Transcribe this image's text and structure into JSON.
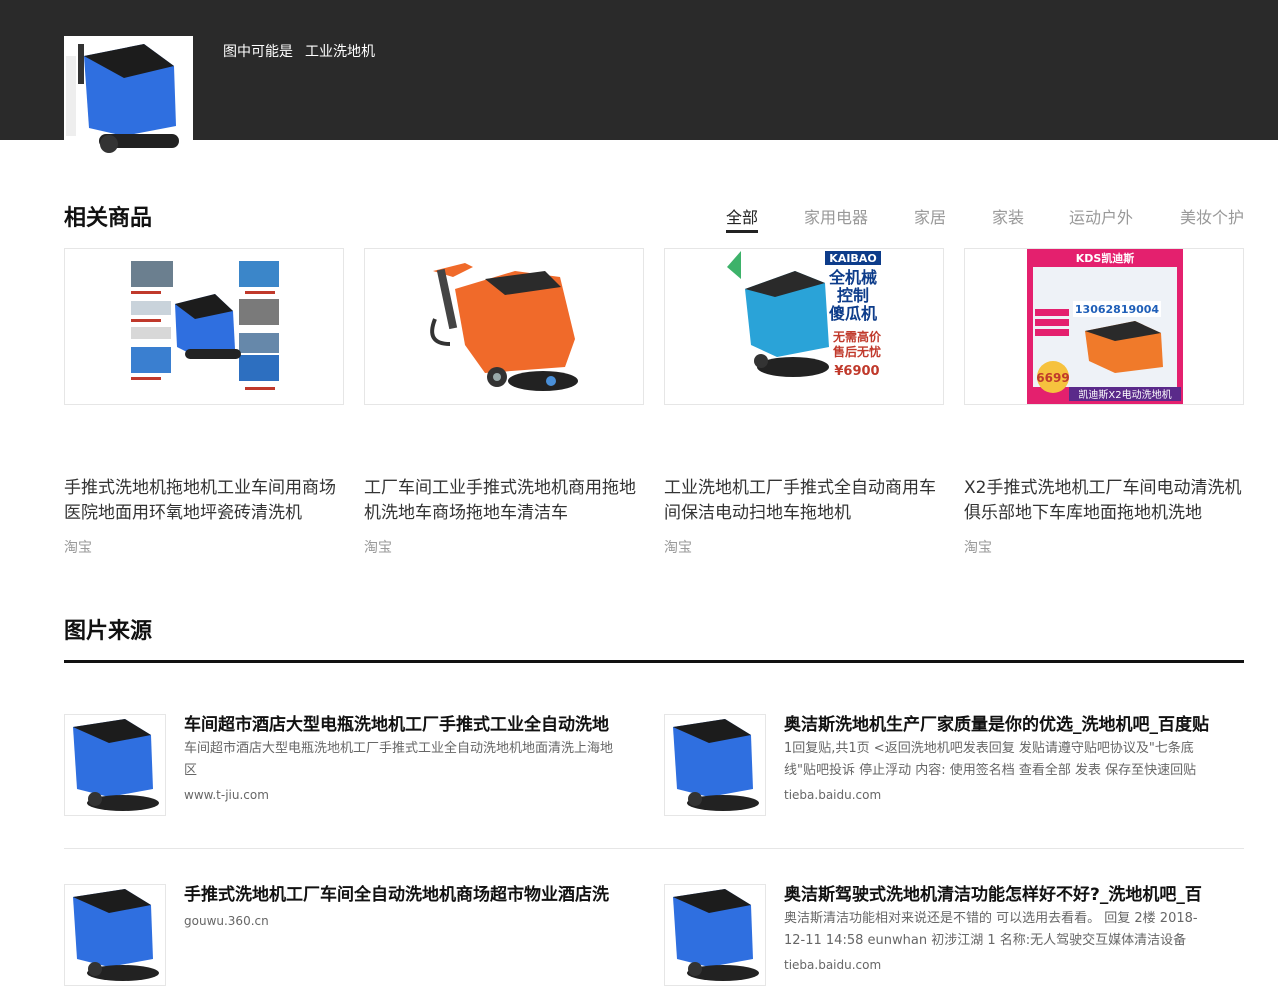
{
  "header": {
    "query_prefix": "图中可能是",
    "query_label": "工业洗地机"
  },
  "related_products": {
    "title": "相关商品",
    "tabs": [
      {
        "label": "全部",
        "active": true
      },
      {
        "label": "家用电器",
        "active": false
      },
      {
        "label": "家居",
        "active": false
      },
      {
        "label": "家装",
        "active": false
      },
      {
        "label": "运动户外",
        "active": false
      },
      {
        "label": "美妆个护",
        "active": false
      }
    ],
    "items": [
      {
        "title": "手推式洗地机拖地机工业车间用商场医院地面用环氧地坪瓷砖清洗机",
        "source": "淘宝",
        "color": "#3a6fd8"
      },
      {
        "title": "工厂车间工业手推式洗地机商用拖地机洗地车商场拖地车清洁车",
        "source": "淘宝",
        "color": "#f06a2a"
      },
      {
        "title": "工业洗地机工厂手推式全自动商用车间保洁电动扫地车拖地机",
        "source": "淘宝",
        "color": "#2aa3d8",
        "overlay": {
          "brand": "KAIBAO",
          "lines": [
            "全机械",
            "控制",
            "傻瓜机"
          ],
          "slogan": [
            "无需高价",
            "售后无忧"
          ],
          "price": "¥6900"
        }
      },
      {
        "title": "X2手推式洗地机工厂车间电动清洗机俱乐部地下车库地面拖地机洗地",
        "source": "淘宝",
        "color": "#f07a2a",
        "overlay": {
          "brand": "KDS凯迪斯",
          "phone": "13062819004",
          "price": "6699",
          "footer": "凯迪斯X2电动洗地机"
        }
      }
    ]
  },
  "image_sources": {
    "title": "图片来源",
    "items": [
      {
        "title": "车间超市酒店大型电瓶洗地机工厂手推式工业全自动洗地",
        "desc": "车间超市酒店大型电瓶洗地机工厂手推式工业全自动洗地机地面清洗上海地区",
        "url": "www.t-jiu.com"
      },
      {
        "title": "奥洁斯洗地机生产厂家质量是你的优选_洗地机吧_百度贴",
        "desc": "1回复贴,共1页 <返回洗地机吧发表回复 发贴请遵守贴吧协议及\"七条底线\"贴吧投诉 停止浮动 内容: 使用签名档 查看全部 发表 保存至快速回贴",
        "url": "tieba.baidu.com"
      },
      {
        "title": "手推式洗地机工厂车间全自动洗地机商场超市物业酒店洗",
        "desc": "",
        "url": "gouwu.360.cn"
      },
      {
        "title": "奥洁斯驾驶式洗地机清洁功能怎样好不好?_洗地机吧_百",
        "desc": "奥洁斯清洁功能相对来说还是不错的 可以选用去看看。 回复 2楼 2018-12-11 14:58 eunwhan 初涉江湖 1 名称:无人驾驶交互媒体清洁设备",
        "url": "tieba.baidu.com"
      }
    ]
  }
}
